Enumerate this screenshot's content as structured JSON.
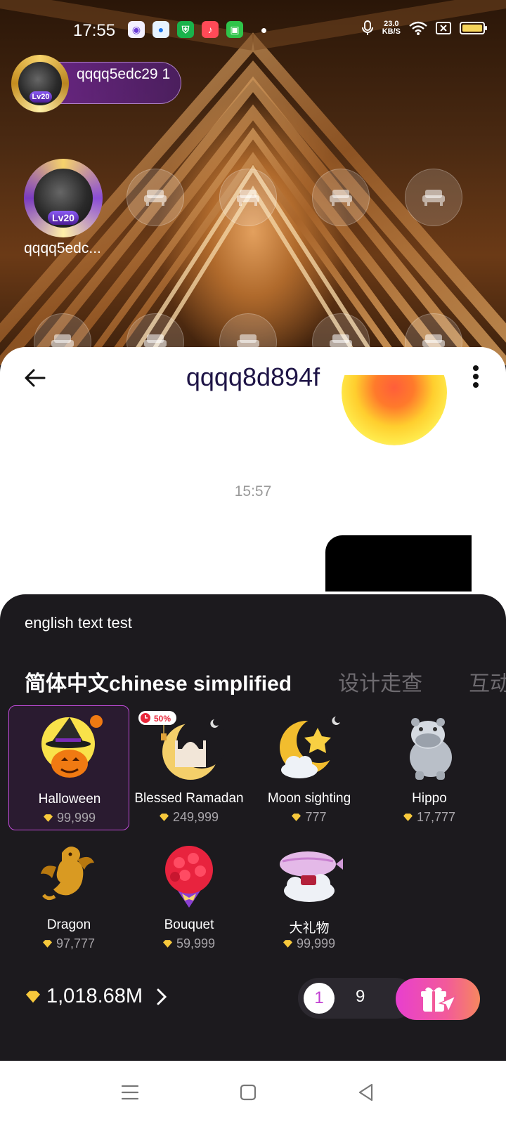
{
  "status_bar": {
    "time": "17:55",
    "net_speed_value": "23.0",
    "net_speed_unit": "KB/S",
    "battery_color": "#f7d55b"
  },
  "room": {
    "host": {
      "name": "qqqq5edc29 1",
      "level": "Lv20"
    },
    "seats": {
      "occupant_name": "qqqq5edc...",
      "occupant_level": "Lv20"
    }
  },
  "chat": {
    "title": "qqqq8d894f",
    "timestamp": "15:57"
  },
  "gift_panel": {
    "notice": "english text test",
    "tabs": [
      {
        "label": "简体中文chinese simplified"
      },
      {
        "label": "设计走查"
      },
      {
        "label": "互动"
      }
    ],
    "gifts": [
      {
        "name": "Halloween",
        "price": "99,999",
        "icon": "halloween-pumpkin"
      },
      {
        "name": "Blessed Ramadan",
        "price": "249,999",
        "icon": "crescent-mosque",
        "badge": "50%"
      },
      {
        "name": "Moon sighting",
        "price": "777",
        "icon": "moon-star-cloud"
      },
      {
        "name": "Hippo",
        "price": "17,777",
        "icon": "silver-hippo"
      },
      {
        "name": "Dragon",
        "price": "97,777",
        "icon": "gold-dragon"
      },
      {
        "name": "Bouquet",
        "price": "59,999",
        "icon": "rose-bouquet"
      },
      {
        "name": "大礼物",
        "price": "99,999",
        "icon": "airship"
      }
    ],
    "balance": "1,018.68M",
    "quantity_selected": "1",
    "quantity_alt": "9",
    "accent": "#e83fcf"
  }
}
